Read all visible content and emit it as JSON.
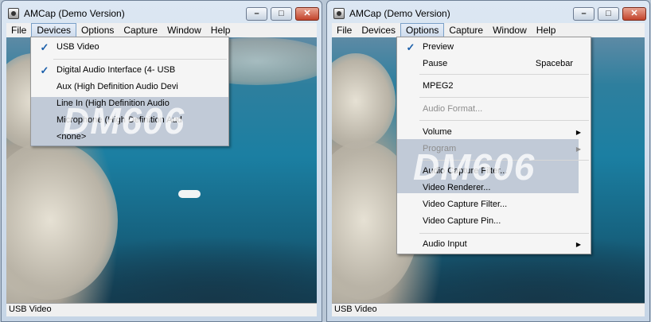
{
  "left_window": {
    "title": "AMCap (Demo Version)",
    "controls": {
      "minimize": "–",
      "maximize": "□",
      "close": "✕"
    },
    "menu": [
      "File",
      "Devices",
      "Options",
      "Capture",
      "Window",
      "Help"
    ],
    "open_menu": "Devices",
    "dropdown": [
      {
        "label": "USB Video",
        "checked": true
      },
      {
        "label": "Digital Audio Interface (4- USB",
        "checked": true
      },
      {
        "label": "Aux (High Definition Audio Devi"
      },
      {
        "label": "Line In (High Definition Audio"
      },
      {
        "label": "Microphone (High Definition Aud"
      },
      {
        "label": "<none>"
      }
    ],
    "watermark": "DM606",
    "status": "USB Video"
  },
  "right_window": {
    "title": "AMCap (Demo Version)",
    "controls": {
      "minimize": "–",
      "maximize": "□",
      "close": "✕"
    },
    "menu": [
      "File",
      "Devices",
      "Options",
      "Capture",
      "Window",
      "Help"
    ],
    "open_menu": "Options",
    "dropdown": [
      {
        "label": "Preview",
        "checked": true
      },
      {
        "label": "Pause",
        "shortcut": "Spacebar"
      },
      {
        "label": "MPEG2"
      },
      {
        "label": "Audio Format...",
        "disabled": true
      },
      {
        "label": "Volume",
        "submenu": true
      },
      {
        "label": "Program",
        "submenu": true,
        "disabled": true
      },
      {
        "label": "Audio Capture Filter..."
      },
      {
        "label": "Video Renderer..."
      },
      {
        "label": "Video Capture Filter..."
      },
      {
        "label": "Video Capture Pin..."
      },
      {
        "label": "Audio Input",
        "submenu": true
      }
    ],
    "watermark": "DM606",
    "status": "USB Video"
  },
  "icons": {
    "check": "✓",
    "submenu_arrow": "▶"
  }
}
